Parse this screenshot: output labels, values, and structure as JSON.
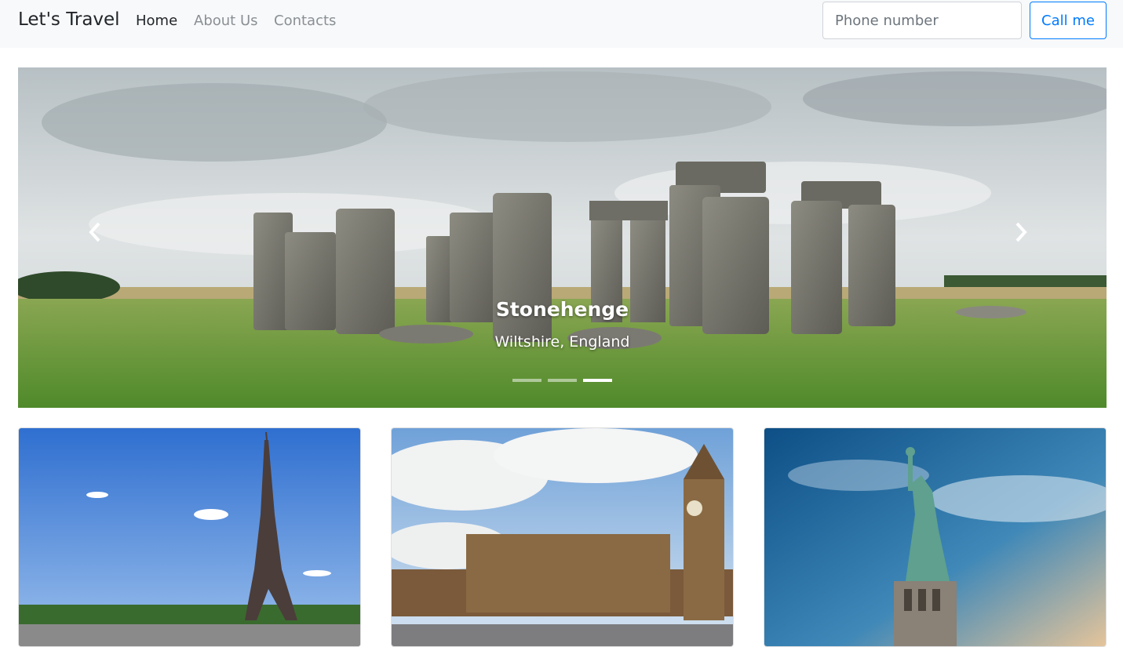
{
  "navbar": {
    "brand": "Let's Travel",
    "links": [
      {
        "label": "Home",
        "active": true
      },
      {
        "label": "About Us",
        "active": false
      },
      {
        "label": "Contacts",
        "active": false
      }
    ],
    "phone_placeholder": "Phone number",
    "call_button": "Call me"
  },
  "carousel": {
    "caption_title": "Stonehenge",
    "caption_subtitle": "Wiltshire, England",
    "prev_icon": "chevron-left-icon",
    "next_icon": "chevron-right-icon",
    "slide_count": 3,
    "active_slide": 3
  },
  "cards": [
    {
      "image": "eiffel-tower-photo"
    },
    {
      "image": "big-ben-parliament-photo"
    },
    {
      "image": "statue-of-liberty-photo"
    }
  ],
  "colors": {
    "accent": "#007bff",
    "navbar_bg": "#f8f9fa"
  }
}
